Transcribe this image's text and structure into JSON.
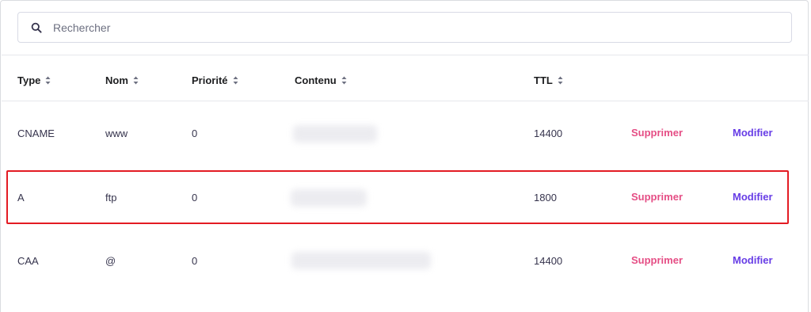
{
  "search": {
    "placeholder": "Rechercher"
  },
  "columns": {
    "type": "Type",
    "name": "Nom",
    "priority": "Priorité",
    "content": "Contenu",
    "ttl": "TTL"
  },
  "rows": [
    {
      "type": "CNAME",
      "name": "www",
      "priority": "0",
      "content": "",
      "ttl": "14400",
      "delete_label": "Supprimer",
      "edit_label": "Modifier",
      "highlighted": false
    },
    {
      "type": "A",
      "name": "ftp",
      "priority": "0",
      "content": "",
      "ttl": "1800",
      "delete_label": "Supprimer",
      "edit_label": "Modifier",
      "highlighted": true
    },
    {
      "type": "CAA",
      "name": "@",
      "priority": "0",
      "content": "",
      "ttl": "14400",
      "delete_label": "Supprimer",
      "edit_label": "Modifier",
      "highlighted": false
    }
  ],
  "icons": {
    "search": "search-icon",
    "sort": "sort-icon"
  },
  "colors": {
    "delete": "#e54e85",
    "edit": "#673de6",
    "highlight": "#e31b23",
    "header_text": "#1d1e20"
  }
}
